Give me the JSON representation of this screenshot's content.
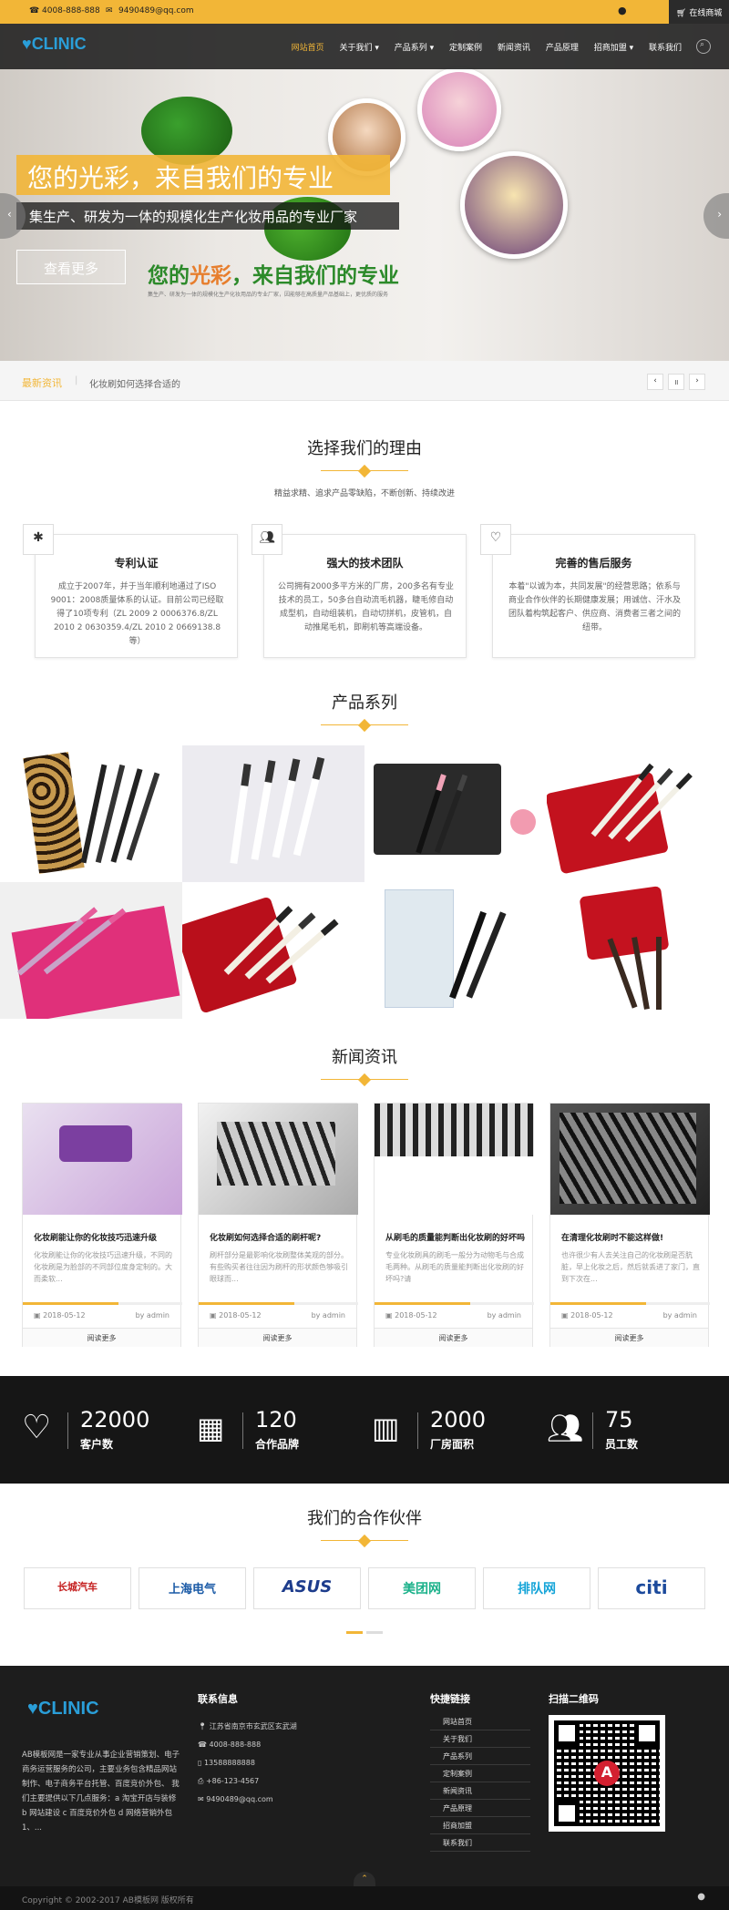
{
  "topbar": {
    "phone": "4008-888-888",
    "email": "9490489@qq.com",
    "online": "在线商城"
  },
  "nav": {
    "logo": "CLINIC",
    "menu": [
      "网站首页",
      "关于我们",
      "产品系列",
      "定制案例",
      "新闻资讯",
      "产品原理",
      "招商加盟",
      "联系我们"
    ]
  },
  "hero": {
    "title": "您的光彩，来自我们的专业",
    "subtitle": "集生产、研发为一体的规模化生产化妆用品的专业厂家",
    "button": "查看更多",
    "green_text_a": "您的",
    "green_text_b": "光彩",
    "green_text_c": "，来自我们的专业",
    "small_text": "集生产、研发为一体的规模化生产化妆用品的专业厂家，因能够在高质量产品基础上，更优质的服务"
  },
  "news_ticker": {
    "label": "最新资讯",
    "item": "化妆刷如何选择合适的"
  },
  "reasons": {
    "title": "选择我们的理由",
    "subtitle": "精益求精、追求产品零缺陷，不断创新、持续改进",
    "cards": [
      {
        "icon": "award-icon",
        "title": "专利认证",
        "text": "成立于2007年，并于当年顺利地通过了ISO 9001：2008质量体系的认证。目前公司已经取得了10项专利（ZL 2009 2 0006376.8/ZL 2010 2 0630359.4/ZL 2010 2 0669138.8等）"
      },
      {
        "icon": "team-icon",
        "title": "强大的技术团队",
        "text": "公司拥有2000多平方米的厂房，200多名有专业技术的员工，50多台自动流毛机器，睫毛修自动成型机，自动组装机，自动切拼机，皮管机，自动推尾毛机，即刷机等高端设备。"
      },
      {
        "icon": "heart-icon",
        "title": "完善的售后服务",
        "text": "本着\"以诚为本，共同发展\"的经营思路；依系与商业合作伙伴的长期健康发展；用诚信、汗水及团队着构筑起客户、供应商、消费者三者之间的纽带。"
      }
    ]
  },
  "products": {
    "title": "产品系列"
  },
  "news": {
    "title": "新闻资讯",
    "items": [
      {
        "title": "化妆刷能让你的化妆技巧迅速升级",
        "text": "化妆刷能让你的化妆技巧迅速升级，不同的化妆刷是为脸部的不同部位度身定制的。大而柔软...",
        "date": "2018-05-12",
        "by": "by admin",
        "more": "阅读更多"
      },
      {
        "title": "化妆刷如何选择合适的刷杆呢?",
        "text": "刷杆部分是最影响化妆刷整体美观的部分。有些购买者往往因为刷杆的形状颜色够吸引眼球而...",
        "date": "2018-05-12",
        "by": "by admin",
        "more": "阅读更多"
      },
      {
        "title": "从刷毛的质量能判断出化妆刷的好坏吗",
        "text": "专业化妆刷具的刷毛一般分为动物毛与合成毛两种。从刷毛的质量能判断出化妆刷的好坏吗?请",
        "date": "2018-05-12",
        "by": "by admin",
        "more": "阅读更多"
      },
      {
        "title": "在清理化妆刷时不能这样做!",
        "text": "也许很少有人去关注自己的化妆刷是否肮脏，早上化妆之后，然后就丢进了家门，直到下次在...",
        "date": "2018-05-12",
        "by": "by admin",
        "more": "阅读更多"
      }
    ]
  },
  "stats": [
    {
      "icon": "heart-icon",
      "num": "22000",
      "label": "客户数"
    },
    {
      "icon": "cubes-icon",
      "num": "120",
      "label": "合作品牌"
    },
    {
      "icon": "building-icon",
      "num": "2000",
      "label": "厂房面积"
    },
    {
      "icon": "users-icon",
      "num": "75",
      "label": "员工数"
    }
  ],
  "partners": {
    "title": "我们的合作伙伴",
    "items": [
      "长城汽车",
      "上海电气",
      "ASUS",
      "美团网",
      "排队网",
      "citi"
    ]
  },
  "footer": {
    "logo": "CLINIC",
    "about": "AB模板网是一家专业从事企业营销策划、电子商务运营服务的公司，主要业务包含精品网站制作、电子商务平台托管、百度竞价外包、 我们主要提供以下几点服务：a 淘宝开店与装修 b 网站建设 c 百度竞价外包 d 网络营销外包 1、...",
    "contact_title": "联系信息",
    "contacts": [
      "江苏省南京市玄武区玄武湖",
      "4008-888-888",
      "13588888888",
      "+86-123-4567",
      "9490489@qq.com"
    ],
    "links_title": "快捷链接",
    "links": [
      "网站首页",
      "关于我们",
      "产品系列",
      "定制案例",
      "新闻资讯",
      "产品原理",
      "招商加盟",
      "联系我们"
    ],
    "qr_title": "扫描二维码",
    "copyright": "Copyright © 2002-2017 AB模板网 版权所有"
  }
}
